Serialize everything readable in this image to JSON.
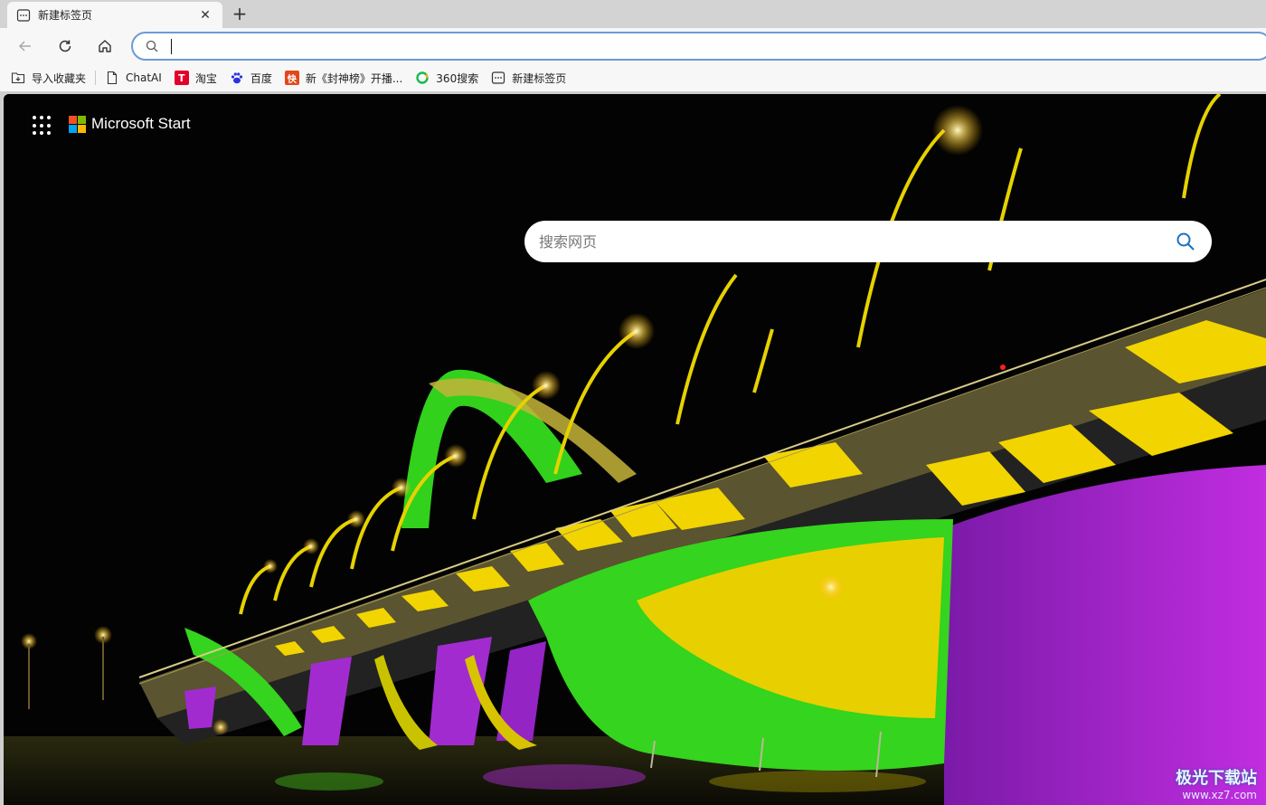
{
  "tab": {
    "title": "新建标签页",
    "close_icon": "close-icon",
    "favicon": "new-tab-page-icon"
  },
  "toolbar": {
    "back_icon": "back-arrow-icon",
    "refresh_icon": "refresh-icon",
    "home_icon": "home-icon",
    "address_value": ""
  },
  "bookmarks": [
    {
      "label": "导入收藏夹",
      "icon": "import-favorites-icon"
    },
    {
      "label": "ChatAI",
      "icon": "page-icon"
    },
    {
      "label": "淘宝",
      "icon": "taobao-icon",
      "color": "#e4002b"
    },
    {
      "label": "百度",
      "icon": "baidu-paw-icon",
      "color": "#2932e1"
    },
    {
      "label": "新《封神榜》开播...",
      "icon": "video-site-icon",
      "color": "#e5471c"
    },
    {
      "label": "360搜索",
      "icon": "360-search-icon",
      "color": "#19b955"
    },
    {
      "label": "新建标签页",
      "icon": "new-tab-page-icon"
    }
  ],
  "page": {
    "brand": "Microsoft Start",
    "search_placeholder": "搜索网页",
    "search_icon": "search-icon",
    "background": "night-illuminated-bridge-photo",
    "logo_colors": [
      "#f25022",
      "#7fba00",
      "#00a4ef",
      "#ffb900"
    ]
  },
  "watermark": {
    "line1": "极光下载站",
    "line2": "www.xz7.com"
  }
}
